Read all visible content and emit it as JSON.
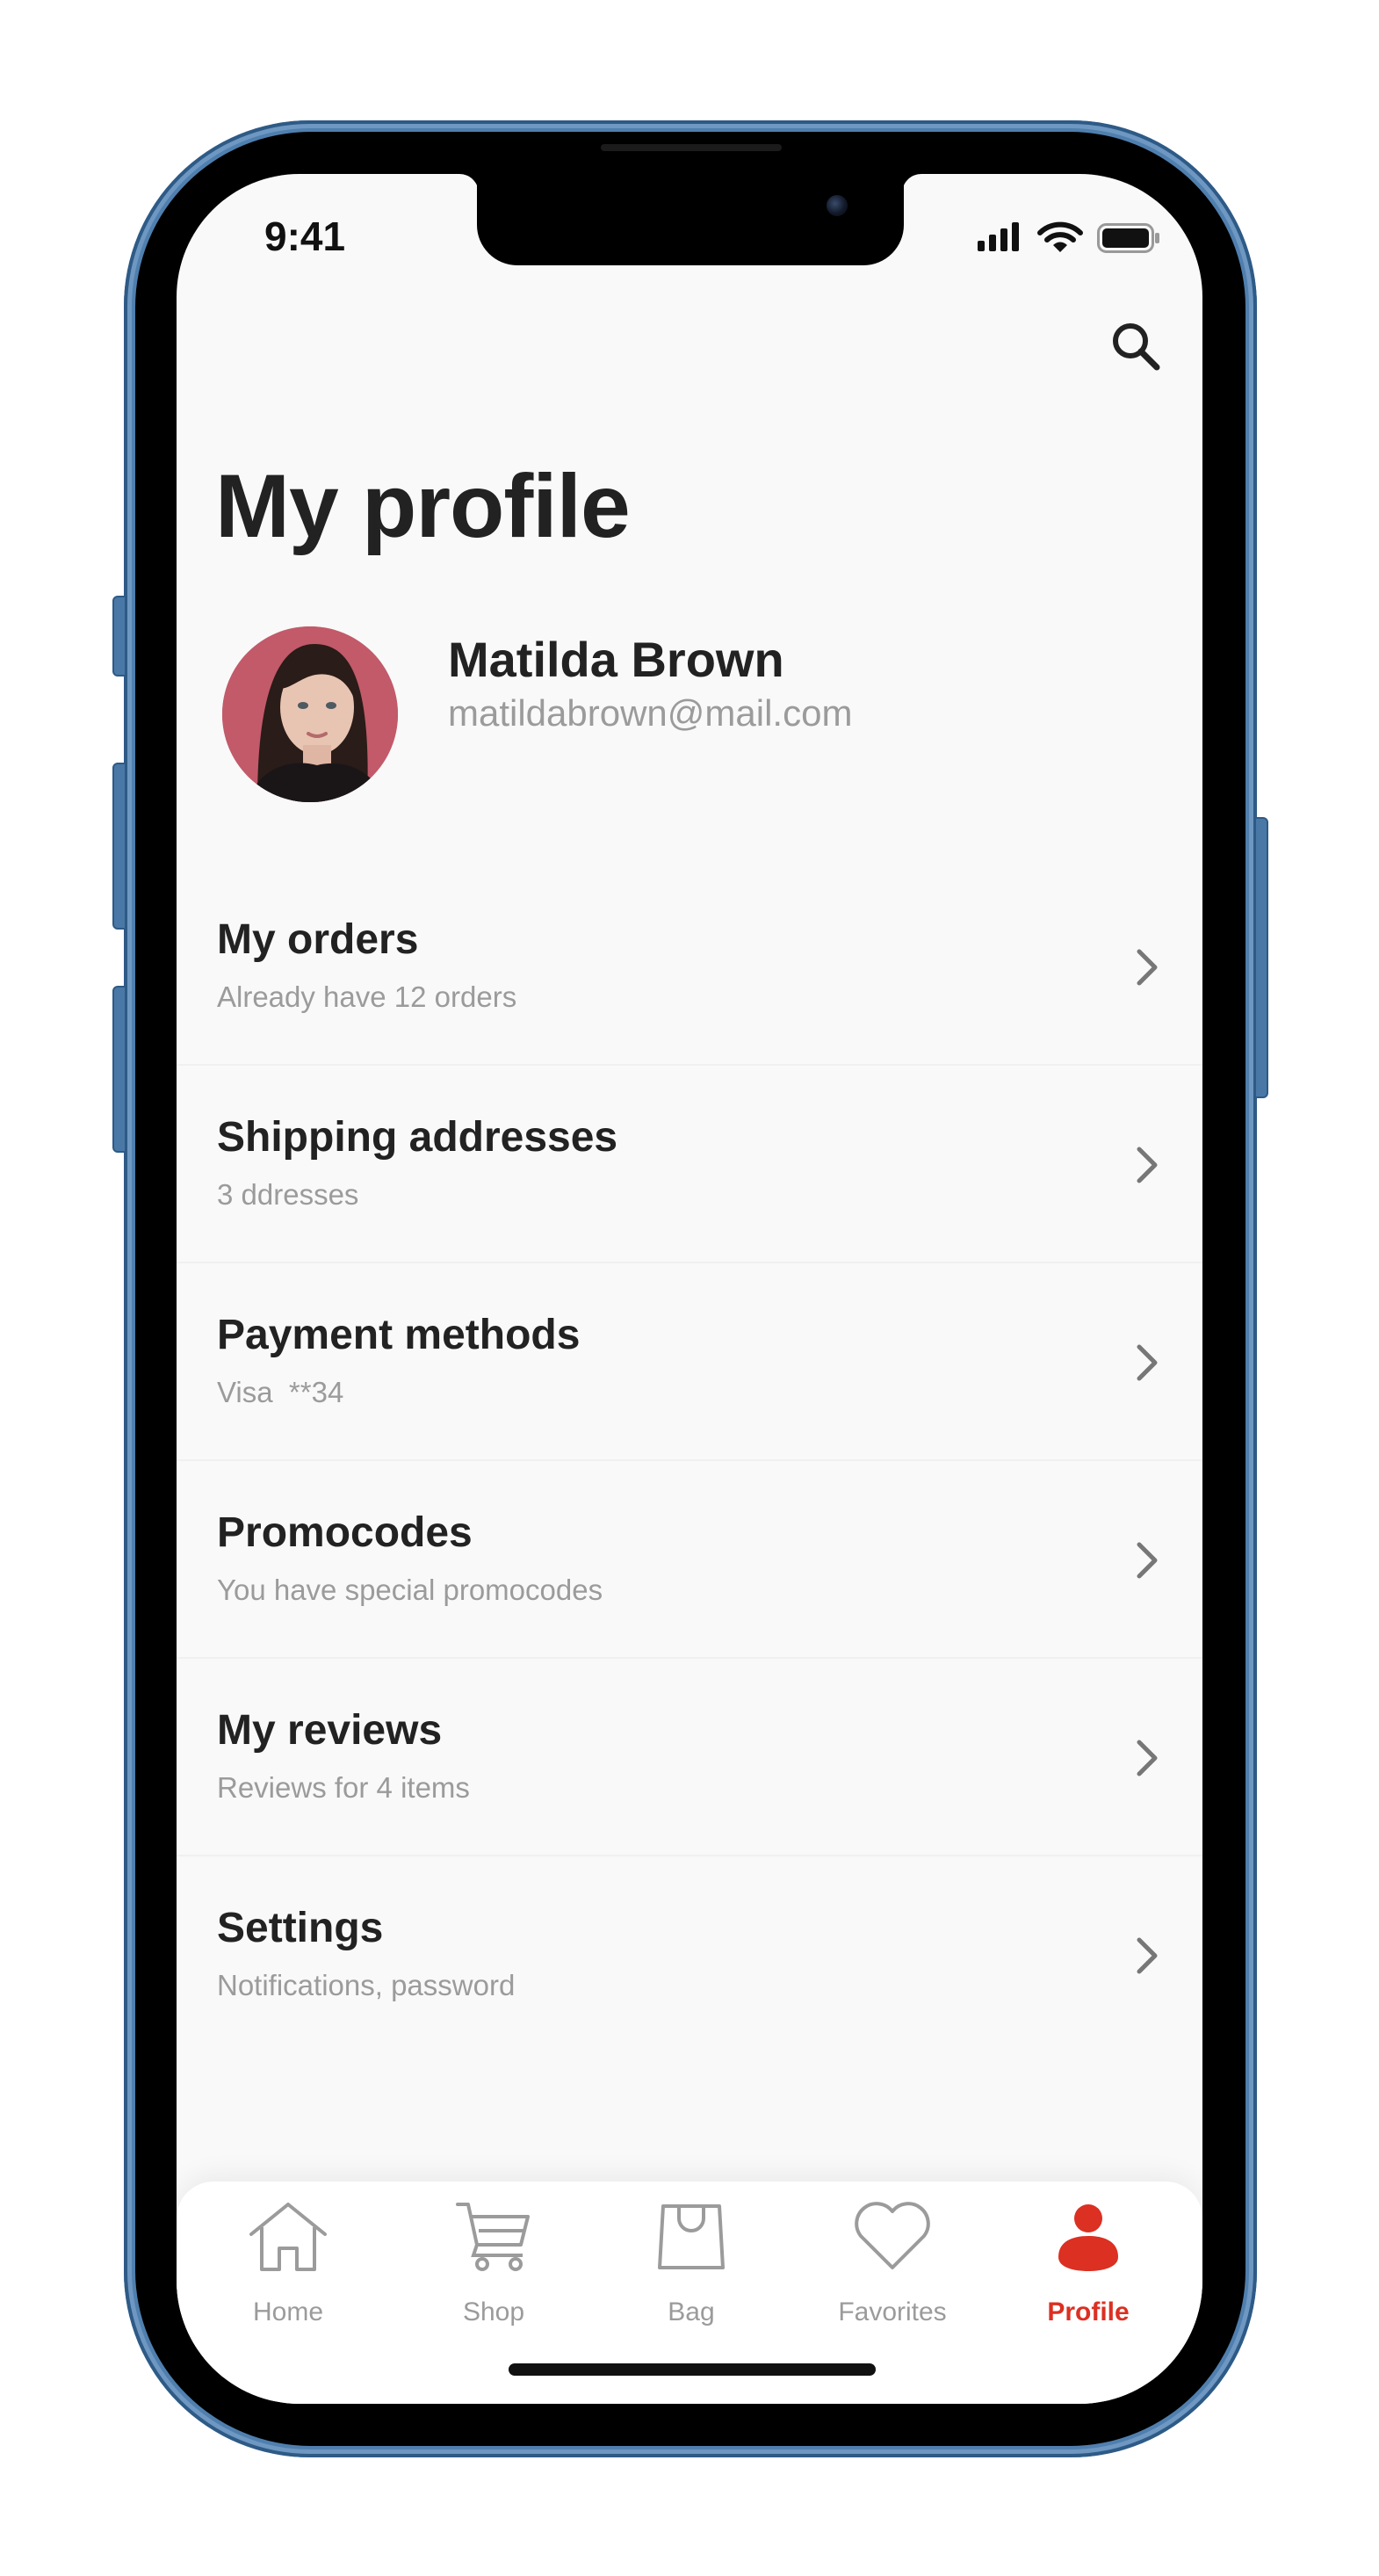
{
  "status_bar": {
    "time": "9:41"
  },
  "header": {
    "title": "My profile"
  },
  "profile": {
    "name": "Matilda Brown",
    "email": "matildabrown@mail.com"
  },
  "menu": [
    {
      "title": "My orders",
      "subtitle": "Already have 12 orders"
    },
    {
      "title": "Shipping addresses",
      "subtitle": "3 ddresses"
    },
    {
      "title": "Payment methods",
      "subtitle": "Visa  **34"
    },
    {
      "title": "Promocodes",
      "subtitle": "You have special promocodes"
    },
    {
      "title": "My reviews",
      "subtitle": "Reviews for 4 items"
    },
    {
      "title": "Settings",
      "subtitle": "Notifications, password"
    }
  ],
  "tabs": [
    {
      "label": "Home",
      "icon": "home-icon",
      "active": false
    },
    {
      "label": "Shop",
      "icon": "cart-icon",
      "active": false
    },
    {
      "label": "Bag",
      "icon": "bag-icon",
      "active": false
    },
    {
      "label": "Favorites",
      "icon": "heart-icon",
      "active": false
    },
    {
      "label": "Profile",
      "icon": "profile-icon",
      "active": true
    }
  ],
  "colors": {
    "accent": "#DB3022",
    "text_primary": "#222222",
    "text_secondary": "#9B9B9B",
    "background": "#F9F9F9",
    "frame": "#4F7FAE"
  }
}
